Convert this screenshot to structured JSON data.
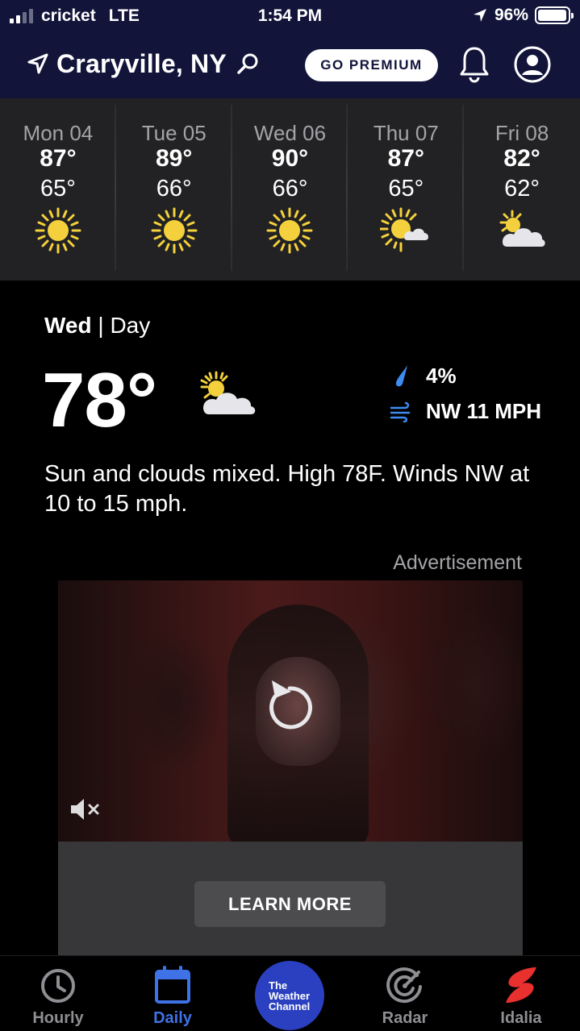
{
  "status_bar": {
    "carrier": "cricket",
    "network": "LTE",
    "time": "1:54 PM",
    "battery": "96%",
    "battery_level": 0.96,
    "signal_bars_active": 2,
    "signal_bars_total": 4
  },
  "header": {
    "location": "Craryville, NY",
    "premium_label": "GO PREMIUM",
    "icons": [
      "location-arrow-icon",
      "search-icon",
      "bell-icon",
      "account-icon"
    ],
    "background_color": "#12143a"
  },
  "forecast": [
    {
      "day": "Mon 04",
      "high": "87°",
      "low": "65°",
      "icon": "sunny-icon"
    },
    {
      "day": "Tue 05",
      "high": "89°",
      "low": "66°",
      "icon": "sunny-icon"
    },
    {
      "day": "Wed 06",
      "high": "90°",
      "low": "66°",
      "icon": "sunny-icon"
    },
    {
      "day": "Thu 07",
      "high": "87°",
      "low": "65°",
      "icon": "mostly-sunny-icon"
    },
    {
      "day": "Fri 08",
      "high": "82°",
      "low": "62°",
      "icon": "partly-cloudy-icon"
    }
  ],
  "detail": {
    "day": "Wed",
    "separator": " | ",
    "period": "Day",
    "temperature": "78°",
    "icon": "partly-cloudy-icon",
    "precip": "4%",
    "wind": "NW 11 MPH",
    "narrative": "Sun and clouds mixed. High 78F. Winds NW at 10 to 15 mph."
  },
  "ad": {
    "label": "Advertisement",
    "cta": "LEARN MORE",
    "icons": [
      "replay-icon",
      "mute-icon"
    ]
  },
  "nav": {
    "items": [
      {
        "label": "Hourly",
        "icon": "clock-icon"
      },
      {
        "label": "Daily",
        "icon": "calendar-icon",
        "active": true
      },
      {
        "label": "Radar",
        "icon": "radar-icon"
      },
      {
        "label": "Idalia",
        "icon": "hurricane-icon"
      }
    ],
    "logo_lines": [
      "The",
      "Weather",
      "Channel"
    ],
    "active_color": "#3f72e6",
    "logo_color": "#2b40c0"
  }
}
